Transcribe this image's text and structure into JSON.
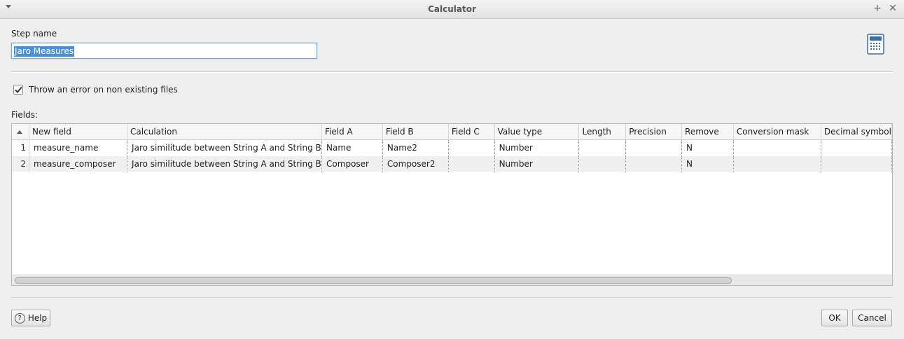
{
  "window": {
    "title": "Calculator"
  },
  "step": {
    "label": "Step name",
    "value": "Jaro Measures"
  },
  "options": {
    "throw_error_label": "Throw an error on non existing files",
    "throw_error_checked": true
  },
  "fields": {
    "label": "Fields:",
    "columns": [
      "New field",
      "Calculation",
      "Field A",
      "Field B",
      "Field C",
      "Value type",
      "Length",
      "Precision",
      "Remove",
      "Conversion mask",
      "Decimal symbol"
    ],
    "rows": [
      {
        "num": "1",
        "cells": [
          "measure_name",
          "Jaro similitude between String A and String B",
          "Name",
          "Name2",
          "",
          "Number",
          "",
          "",
          "N",
          "",
          ""
        ]
      },
      {
        "num": "2",
        "cells": [
          "measure_composer",
          "Jaro similitude between String A and String B",
          "Composer",
          "Composer2",
          "",
          "Number",
          "",
          "",
          "N",
          "",
          ""
        ]
      }
    ]
  },
  "buttons": {
    "help": "Help",
    "ok": "OK",
    "cancel": "Cancel"
  }
}
